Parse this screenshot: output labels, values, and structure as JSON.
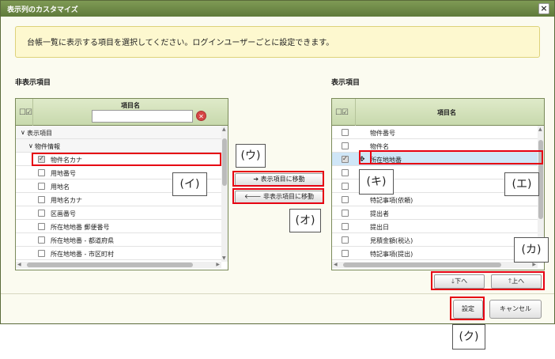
{
  "dialog": {
    "title": "表示列のカスタマイズ",
    "close_label": "×"
  },
  "notice": "台帳一覧に表示する項目を選択してください。ログインユーザーごとに設定できます。",
  "left": {
    "section_title": "非表示項目",
    "col_header": "項目名",
    "filter_value": "",
    "filter_clear_label": "✕",
    "group": "表示項目",
    "subgroup": "物件情報",
    "items": [
      {
        "label": "物件名カナ",
        "checked": true
      },
      {
        "label": "用地番号",
        "checked": false
      },
      {
        "label": "用地名",
        "checked": false
      },
      {
        "label": "用地名カナ",
        "checked": false
      },
      {
        "label": "区画番号",
        "checked": false
      },
      {
        "label": "所在地地番 郵便番号",
        "checked": false
      },
      {
        "label": "所在地地番 - 都道府県",
        "checked": false
      },
      {
        "label": "所在地地番 - 市区町村",
        "checked": false
      }
    ]
  },
  "right": {
    "section_title": "表示項目",
    "col_header": "項目名",
    "items": [
      {
        "label": "物件番号",
        "checked": false
      },
      {
        "label": "物件名",
        "checked": false
      },
      {
        "label": "所在地地番",
        "checked": true
      },
      {
        "label": "",
        "checked": false
      },
      {
        "label": "",
        "checked": false
      },
      {
        "label": "特記事項(依頼)",
        "checked": false
      },
      {
        "label": "提出者",
        "checked": false
      },
      {
        "label": "提出日",
        "checked": false
      },
      {
        "label": "見積金額(税込)",
        "checked": false
      },
      {
        "label": "特記事項(提出)",
        "checked": false
      }
    ]
  },
  "middle": {
    "move_to_display": "表示項目に移動",
    "move_to_hidden": "非表示項目に移動"
  },
  "order": {
    "down": "下へ",
    "up": "上へ"
  },
  "footer": {
    "ok": "設定",
    "cancel": "キャンセル"
  },
  "callouts": {
    "i": "(イ)",
    "u": "(ウ)",
    "o": "(オ)",
    "e": "(エ)",
    "ki": "(キ)",
    "ka": "(カ)",
    "ku": "(ク)"
  },
  "colors": {
    "titlebar": "#6f8a48",
    "highlight": "#e60012",
    "selected_row": "#cfe6f7"
  }
}
